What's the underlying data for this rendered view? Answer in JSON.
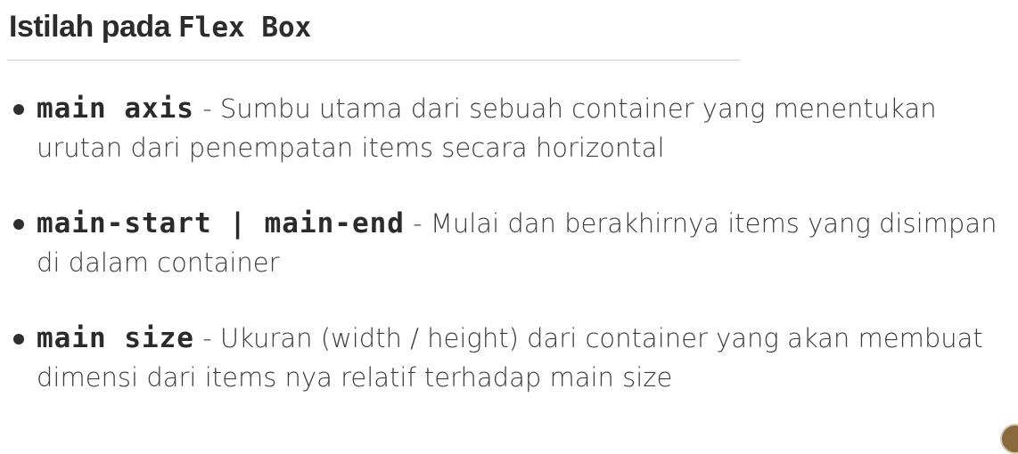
{
  "title": {
    "text": "Istilah pada ",
    "code": "Flex Box"
  },
  "items": [
    {
      "term": "main axis",
      "separator": " - ",
      "description": "Sumbu utama dari sebuah container yang menentukan urutan dari penempatan items secara horizontal"
    },
    {
      "term": "main-start | main-end",
      "separator": " - ",
      "description": "Mulai dan berakhirnya items yang disimpan di dalam container"
    },
    {
      "term": "main size",
      "separator": " - ",
      "description": "Ukuran (width / height) dari container yang akan membuat dimensi dari items nya relatif terhadap main size"
    }
  ],
  "colors": {
    "text": "#3b3b3b",
    "title": "#2c2c2c",
    "rule": "#cfcfcf",
    "background": "#ffffff"
  }
}
